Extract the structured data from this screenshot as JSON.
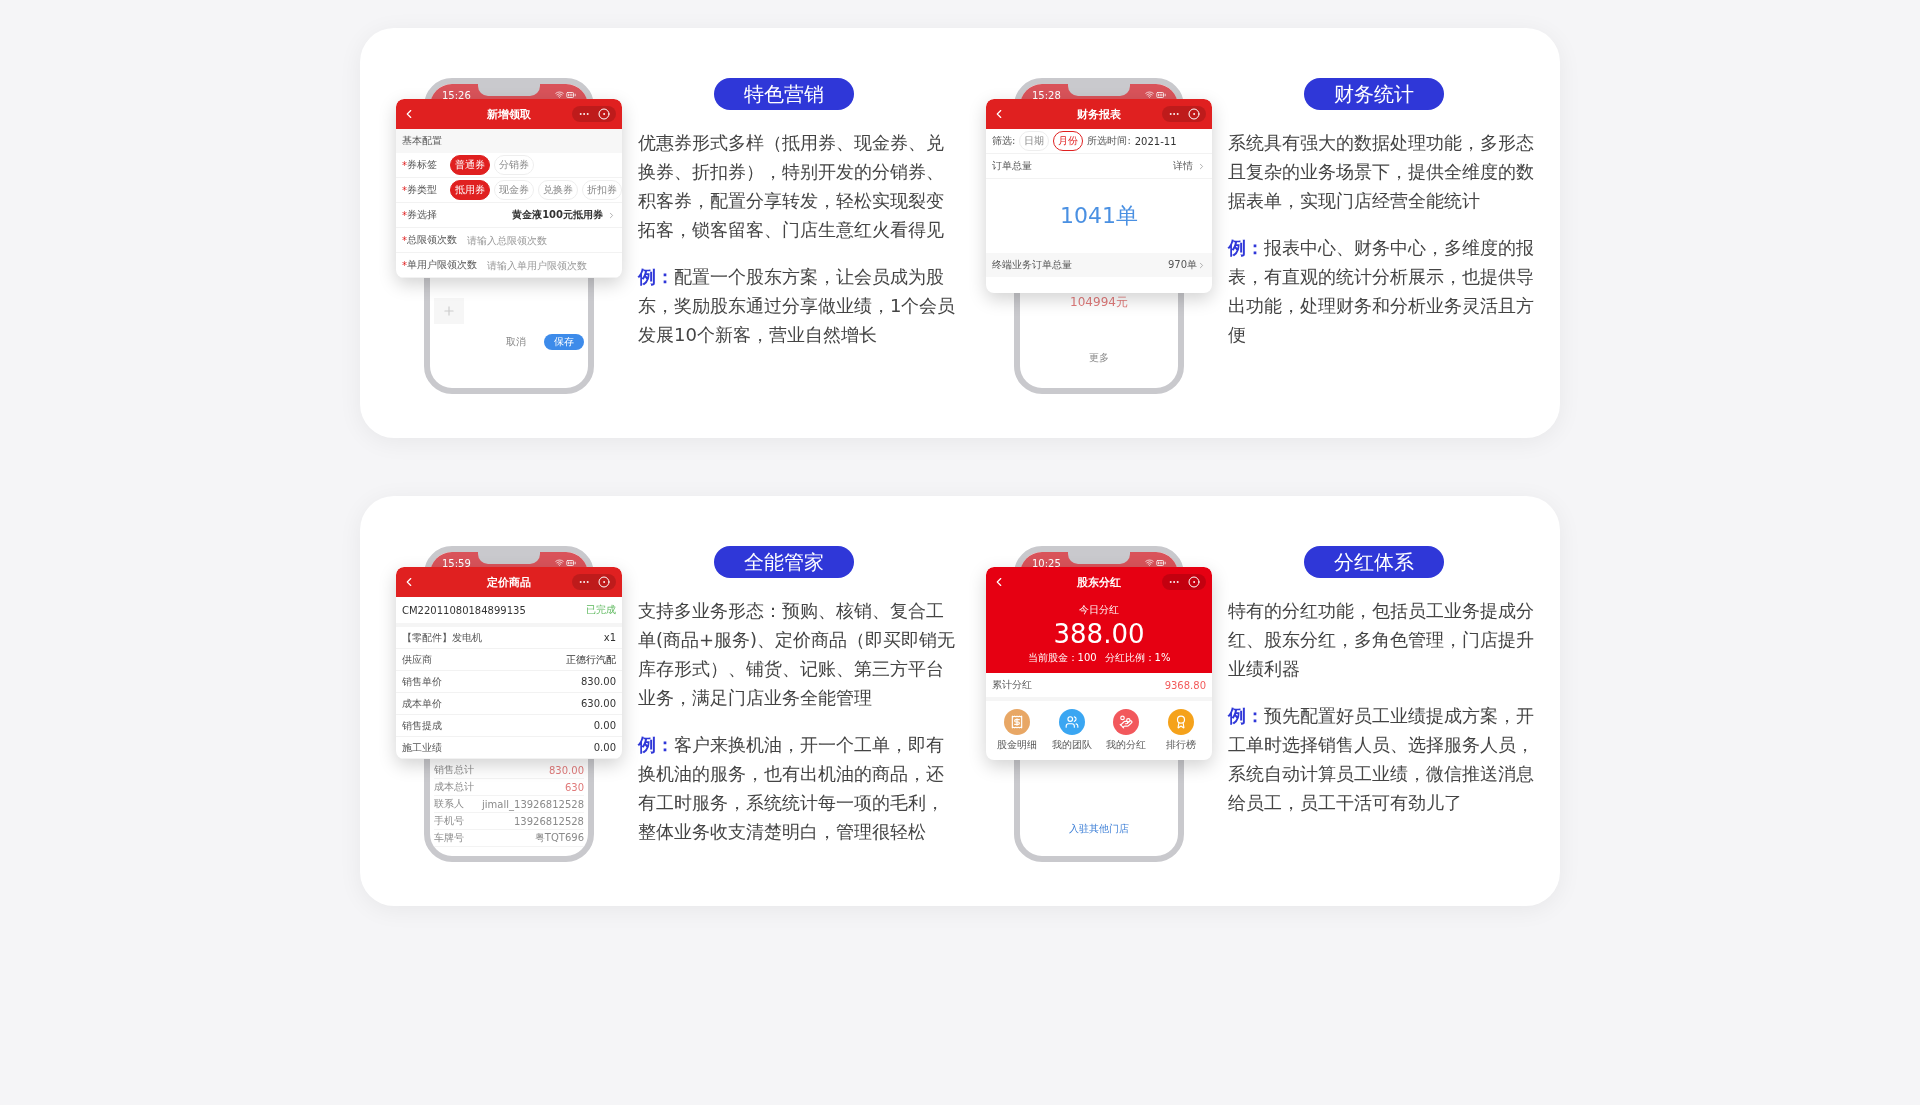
{
  "sections": [
    {
      "features": [
        {
          "title": "特色营销",
          "description": "优惠券形式多样（抵用券、现金券、兑换券、折扣券），特别开发的分销券、积客券，配置分享转发，轻松实现裂变拓客，锁客留客、门店生意红火看得见",
          "example_label": "例：",
          "example": "配置一个股东方案，让会员成为股东，奖励股东通过分享做业绩，1个会员发展10个新客，营业自然增长",
          "phone": {
            "kind": "coupon",
            "time": "15:26",
            "header_title": "新增领取",
            "section_title": "基本配置",
            "rows": [
              {
                "kind": "chips",
                "mark": "*",
                "label": "券标签",
                "chips": [
                  {
                    "label": "普通券",
                    "selected": true
                  },
                  {
                    "label": "分销券",
                    "selected": false
                  }
                ]
              },
              {
                "kind": "chips",
                "mark": "*",
                "label": "券类型",
                "chips": [
                  {
                    "label": "抵用券",
                    "selected": true
                  },
                  {
                    "label": "现金券",
                    "selected": false
                  },
                  {
                    "label": "兑换券",
                    "selected": false
                  },
                  {
                    "label": "折扣券",
                    "selected": false
                  }
                ]
              },
              {
                "kind": "select",
                "mark": "*",
                "label": "券选择",
                "value": "黄金液100元抵用券"
              },
              {
                "kind": "input",
                "mark": "*",
                "label": "总限领次数",
                "placeholder": "请输入总限领次数"
              },
              {
                "kind": "input",
                "mark": "*",
                "label": "单用户限领次数",
                "placeholder": "请输入单用户限领次数"
              }
            ],
            "footer_buttons": [
              {
                "label": "取消",
                "primary": false
              },
              {
                "label": "保存",
                "primary": true
              }
            ]
          }
        },
        {
          "title": "财务统计",
          "description": "系统具有强大的数据处理功能，多形态且复杂的业务场景下，提供全维度的数据表单，实现门店经营全能统计",
          "example_label": "例：",
          "example": "报表中心、财务中心，多维度的报表，有直观的统计分析展示，也提供导出功能，处理财务和分析业务灵活且方便",
          "phone": {
            "kind": "report",
            "time": "15:28",
            "header_title": "财务报表",
            "filter_label": "筛选:",
            "chips": [
              {
                "label": "日期",
                "selected": false
              },
              {
                "label": "月份",
                "selected": true
              }
            ],
            "period_label": "所选时间:",
            "period_value": "2021-11",
            "summary_title": "订单总量",
            "detail_link": "详情",
            "total": "1041单",
            "sub_rows": [
              {
                "label": "终端业务订单总量",
                "value": "970单"
              }
            ],
            "background_amount": "104994元",
            "background_more": "更多"
          }
        }
      ]
    },
    {
      "features": [
        {
          "title": "全能管家",
          "description": "支持多业务形态：预购、核销、复合工单(商品+服务)、定价商品（即买即销无库存形式）、铺货、记账、第三方平台业务，满足门店业务全能管理",
          "example_label": "例：",
          "example": "客户来换机油，开一个工单，即有换机油的服务，也有出机油的商品，还有工时服务，系统统计每一项的毛利，整体业务收支清楚明白，管理很轻松",
          "phone": {
            "kind": "order",
            "time": "15:59",
            "header_title": "定价商品",
            "order_no": "CM22011080184899135",
            "status": "已完成",
            "rows": [
              {
                "label": "【零配件】发电机",
                "value": "x1"
              },
              {
                "label": "供应商",
                "value": "正德行汽配"
              },
              {
                "label": "销售单价",
                "value": "830.00"
              },
              {
                "label": "成本单价",
                "value": "630.00"
              },
              {
                "label": "销售提成",
                "value": "0.00"
              },
              {
                "label": "施工业绩",
                "value": "0.00"
              }
            ],
            "background_rows": [
              {
                "label": "销售总计",
                "value": "830.00"
              },
              {
                "label": "成本总计",
                "value": "630"
              },
              {
                "label": "联系人",
                "value": "jimall_13926812528"
              },
              {
                "label": "手机号",
                "value": "13926812528"
              },
              {
                "label": "车牌号",
                "value": "粤TQT696"
              }
            ]
          }
        },
        {
          "title": "分红体系",
          "description": "特有的分红功能，包括员工业务提成分红、股东分红，多角色管理，门店提升业绩利器",
          "example_label": "例：",
          "example": "预先配置好员工业绩提成方案，开工单时选择销售人员、选择服务人员，系统自动计算员工业绩，微信推送消息给员工，员工干活可有劲儿了",
          "phone": {
            "kind": "dividend",
            "time": "10:25",
            "header_title": "股东分红",
            "today_label": "今日分红",
            "amount": "388.00",
            "stats": [
              "当前股金：100",
              "分红比例：1%"
            ],
            "total_label": "累计分红",
            "total_value": "9368.80",
            "shortcuts": [
              {
                "label": "股金明细",
                "color": "#e8a765"
              },
              {
                "label": "我的团队",
                "color": "#3aa6f2"
              },
              {
                "label": "我的分红",
                "color": "#f2585c"
              },
              {
                "label": "排行榜",
                "color": "#f5a21b"
              }
            ],
            "footer_link": "入驻其他门店"
          }
        }
      ]
    }
  ]
}
